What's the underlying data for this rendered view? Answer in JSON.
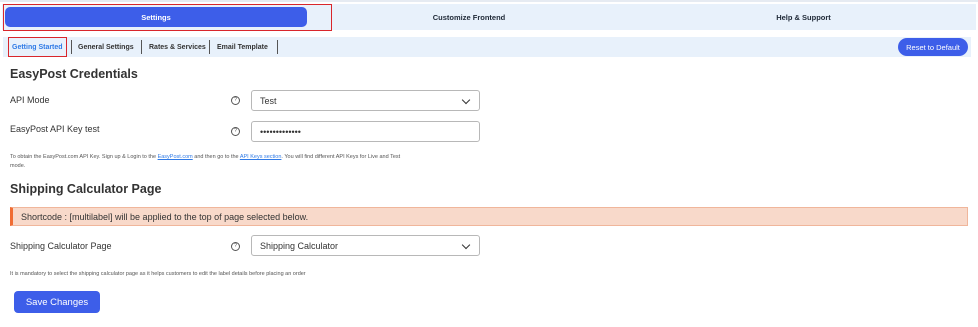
{
  "main_tabs": [
    {
      "label": "Settings",
      "active": true
    },
    {
      "label": "Customize Frontend",
      "active": false
    },
    {
      "label": "Help & Support",
      "active": false
    }
  ],
  "sub_tabs": [
    {
      "label": "Getting Started",
      "active": true
    },
    {
      "label": "General Settings",
      "active": false
    },
    {
      "label": "Rates & Services",
      "active": false
    },
    {
      "label": "Email Template",
      "active": false
    }
  ],
  "reset_label": "Reset to Default",
  "credentials": {
    "heading": "EasyPost Credentials",
    "api_mode_label": "API Mode",
    "api_mode_value": "Test",
    "api_key_label": "EasyPost API Key test",
    "api_key_value": "•••••••••••••",
    "note_pre": "To obtain the EasyPost.com API Key. Sign up & Login to the ",
    "note_link1": "EasyPost.com",
    "note_mid": " and then go to the ",
    "note_link2": "API Keys section",
    "note_post": ". You will find different API Keys for Live and Test",
    "note_line2": "mode."
  },
  "shipping": {
    "heading": "Shipping Calculator Page",
    "notice": "Shortcode : [multilabel] will be applied to the top of page selected below.",
    "page_label": "Shipping Calculator Page",
    "page_value": "Shipping Calculator",
    "note": "It is mandatory to select the shipping calculator page as it helps customers to edit the label details before placing an order"
  },
  "help_glyph": "?",
  "save_label": "Save Changes",
  "colors": {
    "accent": "#3d5ee9",
    "highlight": "#d9262b",
    "notice_bg": "#f8d9ca",
    "notice_border": "#f06d34"
  }
}
